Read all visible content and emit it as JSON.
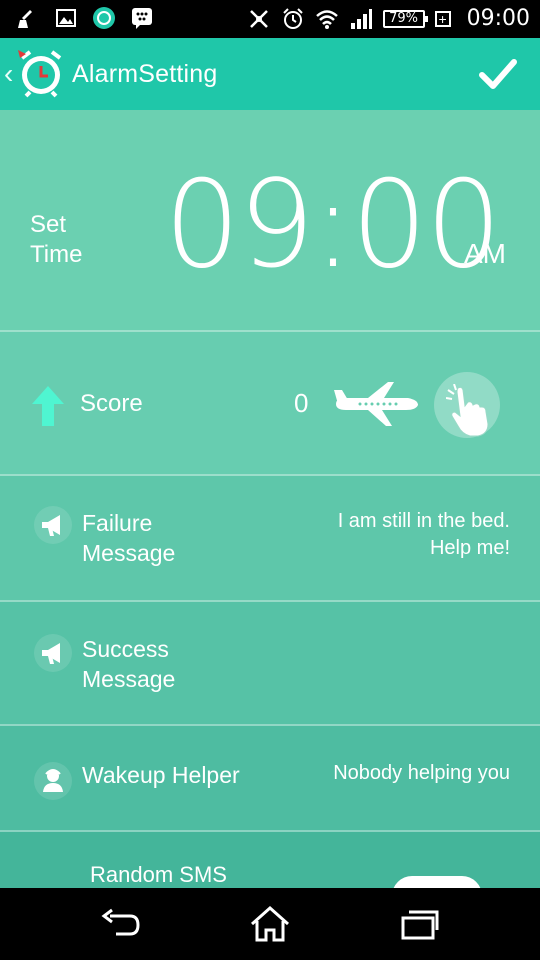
{
  "status_bar": {
    "battery": "79%",
    "time": "09:00",
    "icons": [
      "broom-icon",
      "image-icon",
      "timer-app-icon",
      "bbm-icon",
      "nfc-off-icon",
      "alarm-clock-icon",
      "wifi-icon",
      "signal-icon",
      "battery-icon",
      "plus-box-icon"
    ]
  },
  "app_bar": {
    "title": "AlarmSetting",
    "back_icon": "chevron-left-icon",
    "logo_icon": "alarm-clock-logo-icon",
    "confirm_icon": "checkmark-icon",
    "color": "#1fc7a9"
  },
  "set_time": {
    "label_line1": "Set",
    "label_line2": "Time",
    "time": "09:00",
    "period": "AM"
  },
  "score": {
    "label": "Score",
    "value": "0",
    "icons": [
      "up-arrow-icon",
      "airplane-icon",
      "tap-hand-icon"
    ],
    "arrow_color": "#4ff5d1"
  },
  "failure_message": {
    "title_line1": "Failure",
    "title_line2": "Message",
    "value_line1": "I am still in the bed.",
    "value_line2": "Help me!",
    "icon": "megaphone-icon"
  },
  "success_message": {
    "title_line1": "Success",
    "title_line2": "Message",
    "icon": "megaphone-icon"
  },
  "wakeup_helper": {
    "title": "Wakeup Helper",
    "value": "Nobody helping you",
    "icon": "person-icon"
  },
  "random_sms": {
    "title": "Random SMS"
  },
  "nav_bar": {
    "icons": [
      "back-nav-icon",
      "home-nav-icon",
      "recent-apps-icon"
    ]
  }
}
